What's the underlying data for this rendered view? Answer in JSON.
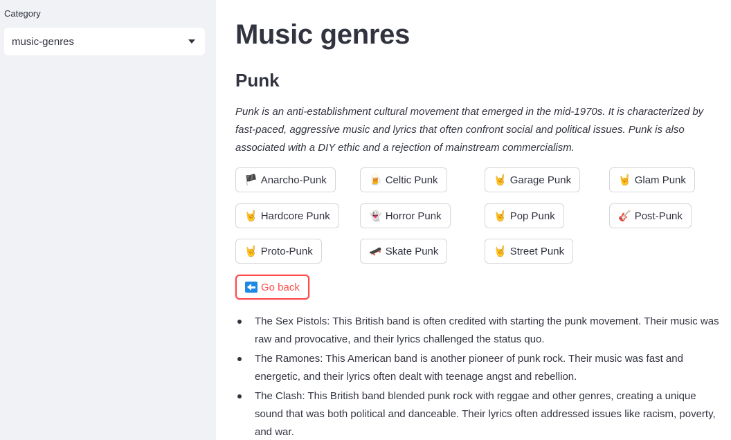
{
  "sidebar": {
    "category_label": "Category",
    "category_value": "music-genres"
  },
  "main": {
    "title": "Music genres",
    "subtitle": "Punk",
    "description": "Punk is an anti-establishment cultural movement that emerged in the mid-1970s. It is characterized by fast-paced, aggressive music and lyrics that often confront social and political issues. Punk is also associated with a DIY ethic and a rejection of mainstream commercialism.",
    "genre_buttons": [
      {
        "icon": "🏴",
        "label": "Anarcho-Punk"
      },
      {
        "icon": "🍺",
        "label": "Celtic Punk"
      },
      {
        "icon": "🤘",
        "label": "Garage Punk"
      },
      {
        "icon": "🤘",
        "label": "Glam Punk"
      },
      {
        "icon": "🤘",
        "label": "Hardcore Punk"
      },
      {
        "icon": "👻",
        "label": "Horror Punk"
      },
      {
        "icon": "🤘",
        "label": "Pop Punk"
      },
      {
        "icon": "🎸",
        "label": "Post-Punk"
      },
      {
        "icon": "🤘",
        "label": "Proto-Punk"
      },
      {
        "icon": "🛹",
        "label": "Skate Punk"
      },
      {
        "icon": "🤘",
        "label": "Street Punk"
      }
    ],
    "back_button": {
      "icon": "back-arrow-icon",
      "label": "Go back"
    },
    "bands": [
      "The Sex Pistols: This British band is often credited with starting the punk movement. Their music was raw and provocative, and their lyrics challenged the status quo.",
      "The Ramones: This American band is another pioneer of punk rock. Their music was fast and energetic, and their lyrics often dealt with teenage angst and rebellion.",
      "The Clash: This British band blended punk rock with reggae and other genres, creating a unique sound that was both political and danceable. Their lyrics often addressed issues like racism, poverty, and war."
    ]
  },
  "colors": {
    "accent": "#ff4b4b",
    "sidebar_bg": "#f0f2f6",
    "text": "#31333f"
  }
}
